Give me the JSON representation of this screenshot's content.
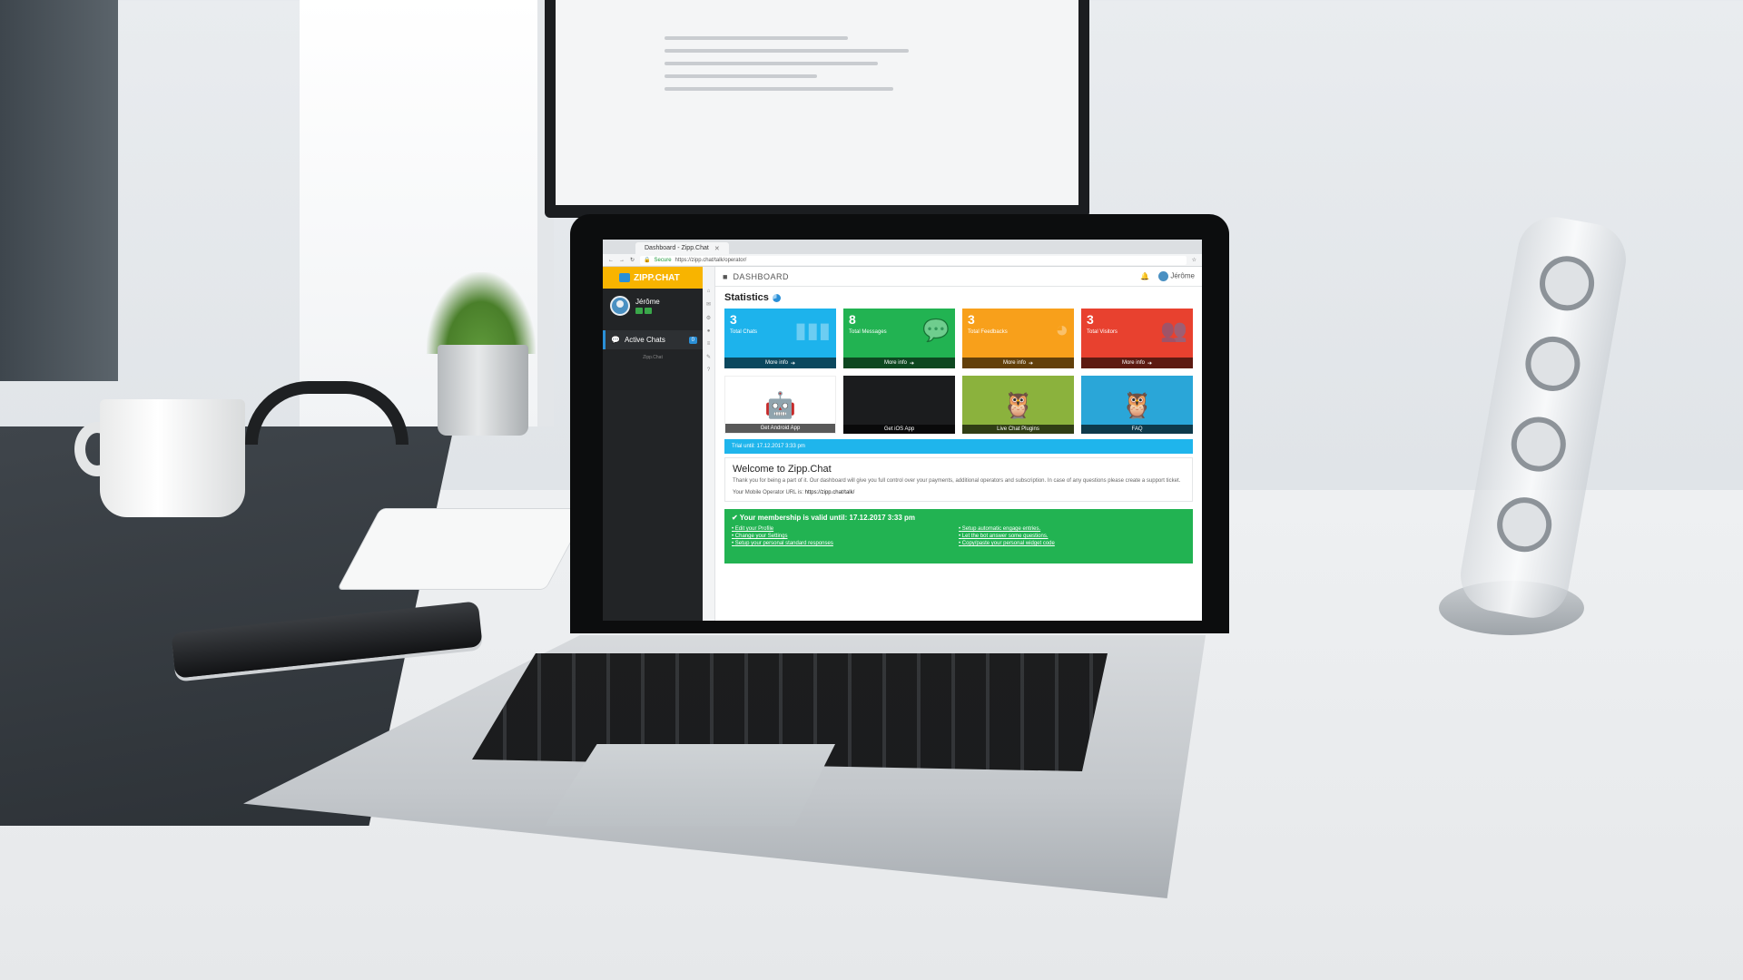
{
  "browser": {
    "tab_title": "Dashboard - Zipp.Chat",
    "secure_label": "Secure",
    "url": "https://zipp.chat/talk/operator/"
  },
  "sidebar": {
    "brand": "ZIPP.CHAT",
    "user_name": "Jérôme",
    "nav_active_chats": "Active Chats",
    "nav_active_chats_badge": "0",
    "footer": "Zipp.Chat"
  },
  "topbar": {
    "title": "DASHBOARD",
    "user_name": "Jérôme"
  },
  "statistics": {
    "title": "Statistics",
    "cards": [
      {
        "value": "3",
        "label": "Total Chats",
        "more": "More info",
        "color": "#1db3ec",
        "icon": "bar-chart-icon"
      },
      {
        "value": "8",
        "label": "Total Messages",
        "more": "More info",
        "color": "#22b352",
        "icon": "chat-bubbles-icon"
      },
      {
        "value": "3",
        "label": "Total Feedbacks",
        "more": "More info",
        "color": "#f8a01b",
        "icon": "pie-chart-icon"
      },
      {
        "value": "3",
        "label": "Total Visitors",
        "more": "More info",
        "color": "#e8412f",
        "icon": "users-icon"
      }
    ]
  },
  "apps": [
    {
      "label": "Get Android App",
      "icon": "android-icon",
      "bg": "#ffffff"
    },
    {
      "label": "Get iOS App",
      "icon": "apple-icon",
      "bg": "#1b1c1e"
    },
    {
      "label": "Live Chat Plugins",
      "icon": "owl-worker-icon",
      "bg": "#8bb23d"
    },
    {
      "label": "FAQ",
      "icon": "owl-nurse-icon",
      "bg": "#2aa6d8"
    }
  ],
  "trial": "Trial until: 17.12.2017 3:33 pm",
  "welcome": {
    "title": "Welcome to Zipp.Chat",
    "text": "Thank you for being a part of it. Our dashboard will give you full control over your payments, additional operators and subscription. In case of any questions please create a support ticket.",
    "url_label": "Your Mobile Operator URL is:",
    "url_value": "https://zipp.chat/talk/"
  },
  "membership": {
    "title": "Your membership is valid until: 17.12.2017 3:33 pm",
    "links_left": [
      "Edit your Profile",
      "Change your Settings",
      "Setup your personal standard responses"
    ],
    "links_right": [
      "Setup automatic engage entries.",
      "Let the bot answer some questions.",
      "Copy/paste your personal widget code"
    ]
  }
}
